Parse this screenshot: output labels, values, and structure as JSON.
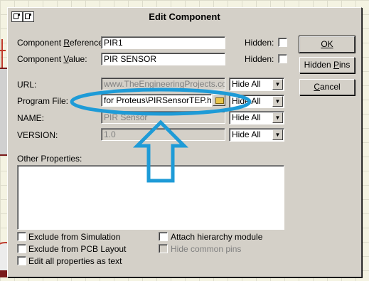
{
  "window": {
    "title": "Edit Component"
  },
  "fields": {
    "reference": {
      "label": "Component Reference:",
      "value": "PIR1",
      "hidden_label": "Hidden:"
    },
    "value": {
      "label": "Component Value:",
      "value": "PIR SENSOR",
      "hidden_label": "Hidden:"
    },
    "url": {
      "label": "URL:",
      "value": "www.TheEngineeringProjects.com",
      "select": "Hide All"
    },
    "program_file": {
      "label": "Program File:",
      "value": "for Proteus\\PIRSensorTEP.hex",
      "select": "Hide All"
    },
    "name": {
      "label": "NAME:",
      "value": "PIR Sensor",
      "select": "Hide All"
    },
    "version": {
      "label": "VERSION:",
      "value": "1.0",
      "select": "Hide All"
    },
    "other_properties": {
      "label": "Other Properties:"
    }
  },
  "buttons": {
    "ok": "OK",
    "hidden_pins": "Hidden Pins",
    "cancel": "Cancel"
  },
  "checkboxes": {
    "exclude_simulation": "Exclude from Simulation",
    "exclude_pcb": "Exclude from PCB Layout",
    "edit_all": "Edit all properties as text",
    "attach_hierarchy": "Attach hierarchy module",
    "hide_common_pins": "Hide common pins"
  },
  "annotation": {
    "color": "#1e9bd7"
  },
  "icons": {
    "browse": "folder-icon",
    "dropdown": "chevron-down-icon"
  }
}
